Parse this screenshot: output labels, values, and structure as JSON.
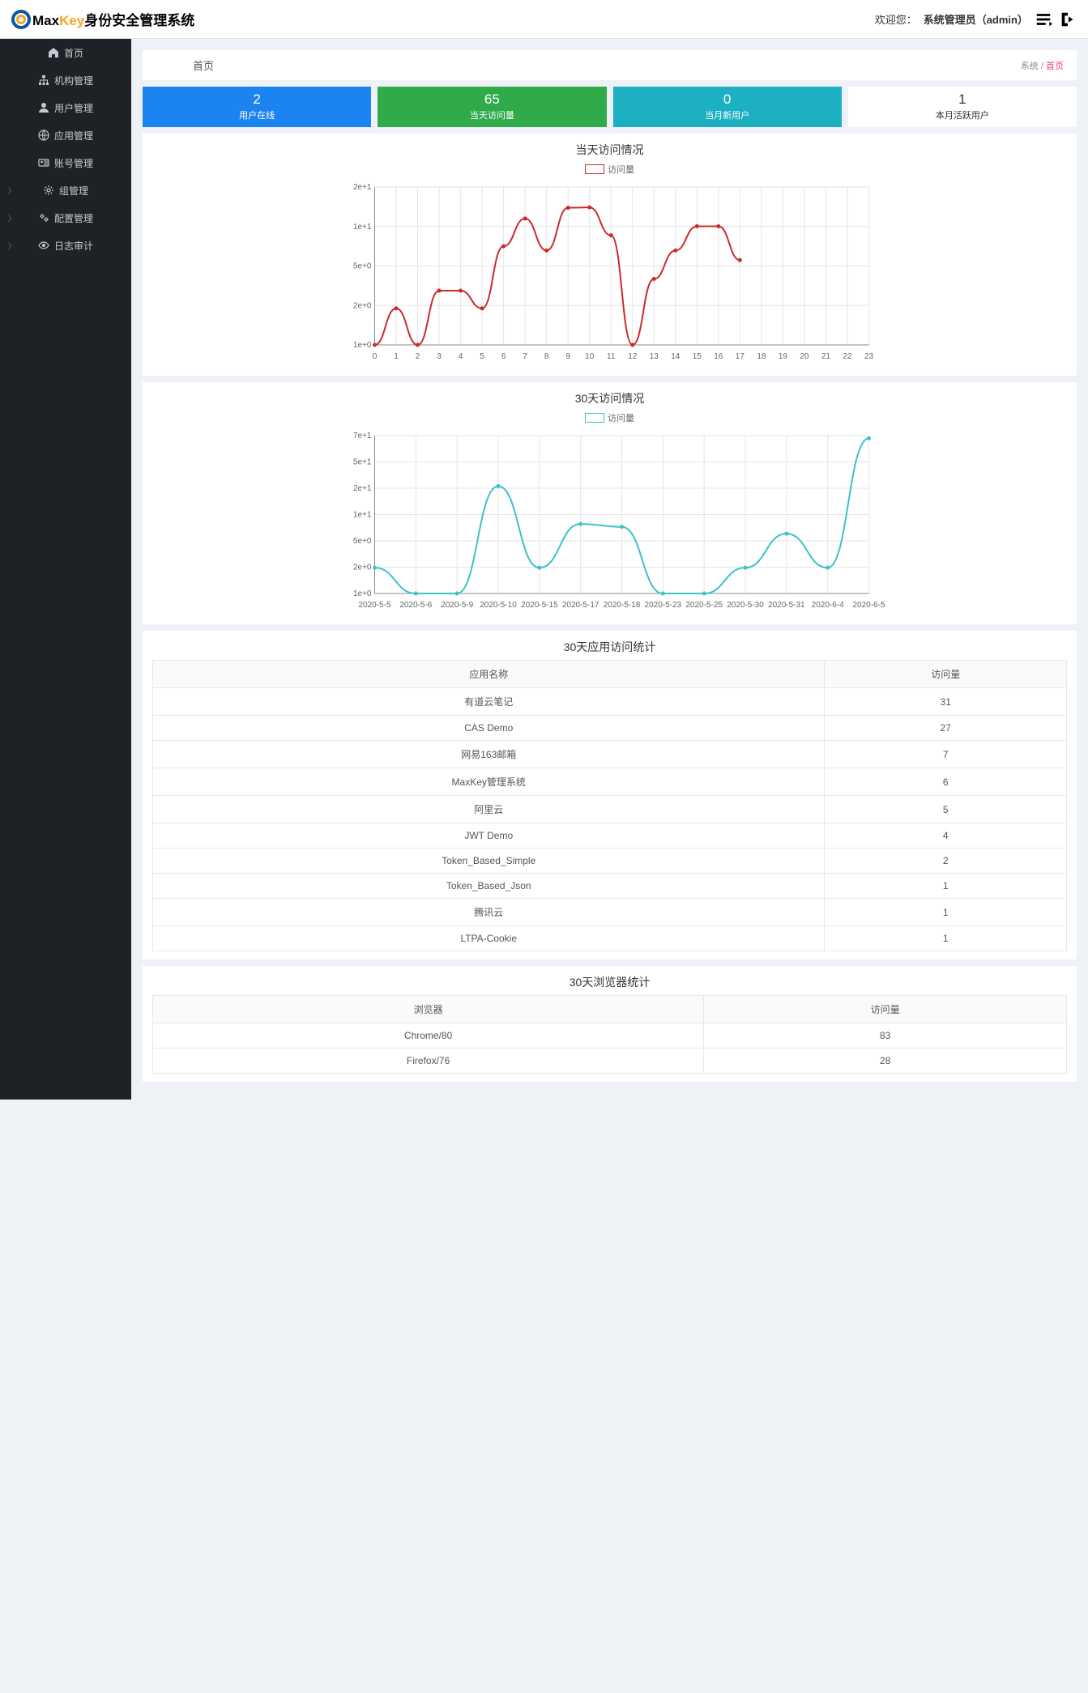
{
  "header": {
    "logo_max": "Max",
    "logo_key": "Key",
    "logo_rest": "身份安全管理系统",
    "welcome": "欢迎您：",
    "user": "系统管理员（admin）"
  },
  "sidebar": {
    "items": [
      {
        "label": "首页",
        "icon": "home",
        "expand": false
      },
      {
        "label": "机构管理",
        "icon": "sitemap",
        "expand": false
      },
      {
        "label": "用户管理",
        "icon": "user",
        "expand": false
      },
      {
        "label": "应用管理",
        "icon": "globe",
        "expand": false
      },
      {
        "label": "账号管理",
        "icon": "idcard",
        "expand": false
      },
      {
        "label": "组管理",
        "icon": "cog",
        "expand": true
      },
      {
        "label": "配置管理",
        "icon": "gears",
        "expand": true
      },
      {
        "label": "日志审计",
        "icon": "eye",
        "expand": true
      }
    ]
  },
  "crumb": {
    "title": "首页",
    "sys": "系统",
    "sep": " / ",
    "cur": "首页"
  },
  "cards": [
    {
      "num": "2",
      "label": "用户在线",
      "cls": "blue"
    },
    {
      "num": "65",
      "label": "当天访问量",
      "cls": "green"
    },
    {
      "num": "0",
      "label": "当月新用户",
      "cls": "cyan"
    },
    {
      "num": "1",
      "label": "本月活跃用户",
      "cls": "white"
    }
  ],
  "chart_data": [
    {
      "type": "line",
      "title": "当天访问情况",
      "legend": "访问量",
      "color": "red",
      "x_labels": [
        "0",
        "1",
        "2",
        "3",
        "4",
        "5",
        "6",
        "7",
        "8",
        "9",
        "10",
        "11",
        "12",
        "13",
        "14",
        "15",
        "16",
        "17",
        "18",
        "19",
        "20",
        "21",
        "22",
        "23"
      ],
      "y_ticks": [
        "1e+0",
        "2e+0",
        "5e+0",
        "1e+1",
        "2e+1"
      ],
      "values": [
        1,
        2,
        1,
        2.8,
        2.8,
        2,
        6.5,
        11,
        6,
        13.5,
        13.6,
        8,
        1,
        3.5,
        6,
        9.5,
        9.5,
        5
      ]
    },
    {
      "type": "line",
      "title": "30天访问情况",
      "legend": "访问量",
      "color": "cyan",
      "x_labels": [
        "2020-5-5",
        "2020-5-6",
        "2020-5-9",
        "2020-5-10",
        "2020-5-15",
        "2020-5-17",
        "2020-5-18",
        "2020-5-23",
        "2020-5-25",
        "2020-5-30",
        "2020-5-31",
        "2020-6-4",
        "2020-6-5"
      ],
      "y_ticks": [
        "1e+0",
        "2e+0",
        "5e+0",
        "1e+1",
        "2e+1",
        "5e+1",
        "7e+1"
      ],
      "values": [
        2,
        1,
        1,
        18,
        2,
        6.5,
        6,
        1,
        1,
        2,
        5,
        2,
        65
      ]
    }
  ],
  "table_apps": {
    "title": "30天应用访问统计",
    "col1": "应用名称",
    "col2": "访问量",
    "rows": [
      {
        "name": "有道云笔记",
        "count": "31"
      },
      {
        "name": "CAS Demo",
        "count": "27"
      },
      {
        "name": "网易163邮箱",
        "count": "7"
      },
      {
        "name": "MaxKey管理系统",
        "count": "6"
      },
      {
        "name": "阿里云",
        "count": "5"
      },
      {
        "name": "JWT Demo",
        "count": "4"
      },
      {
        "name": "Token_Based_Simple",
        "count": "2"
      },
      {
        "name": "Token_Based_Json",
        "count": "1"
      },
      {
        "name": "腾讯云",
        "count": "1"
      },
      {
        "name": "LTPA-Cookie",
        "count": "1"
      }
    ]
  },
  "table_browsers": {
    "title": "30天浏览器统计",
    "col1": "浏览器",
    "col2": "访问量",
    "rows": [
      {
        "name": "Chrome/80",
        "count": "83"
      },
      {
        "name": "Firefox/76",
        "count": "28"
      }
    ]
  }
}
